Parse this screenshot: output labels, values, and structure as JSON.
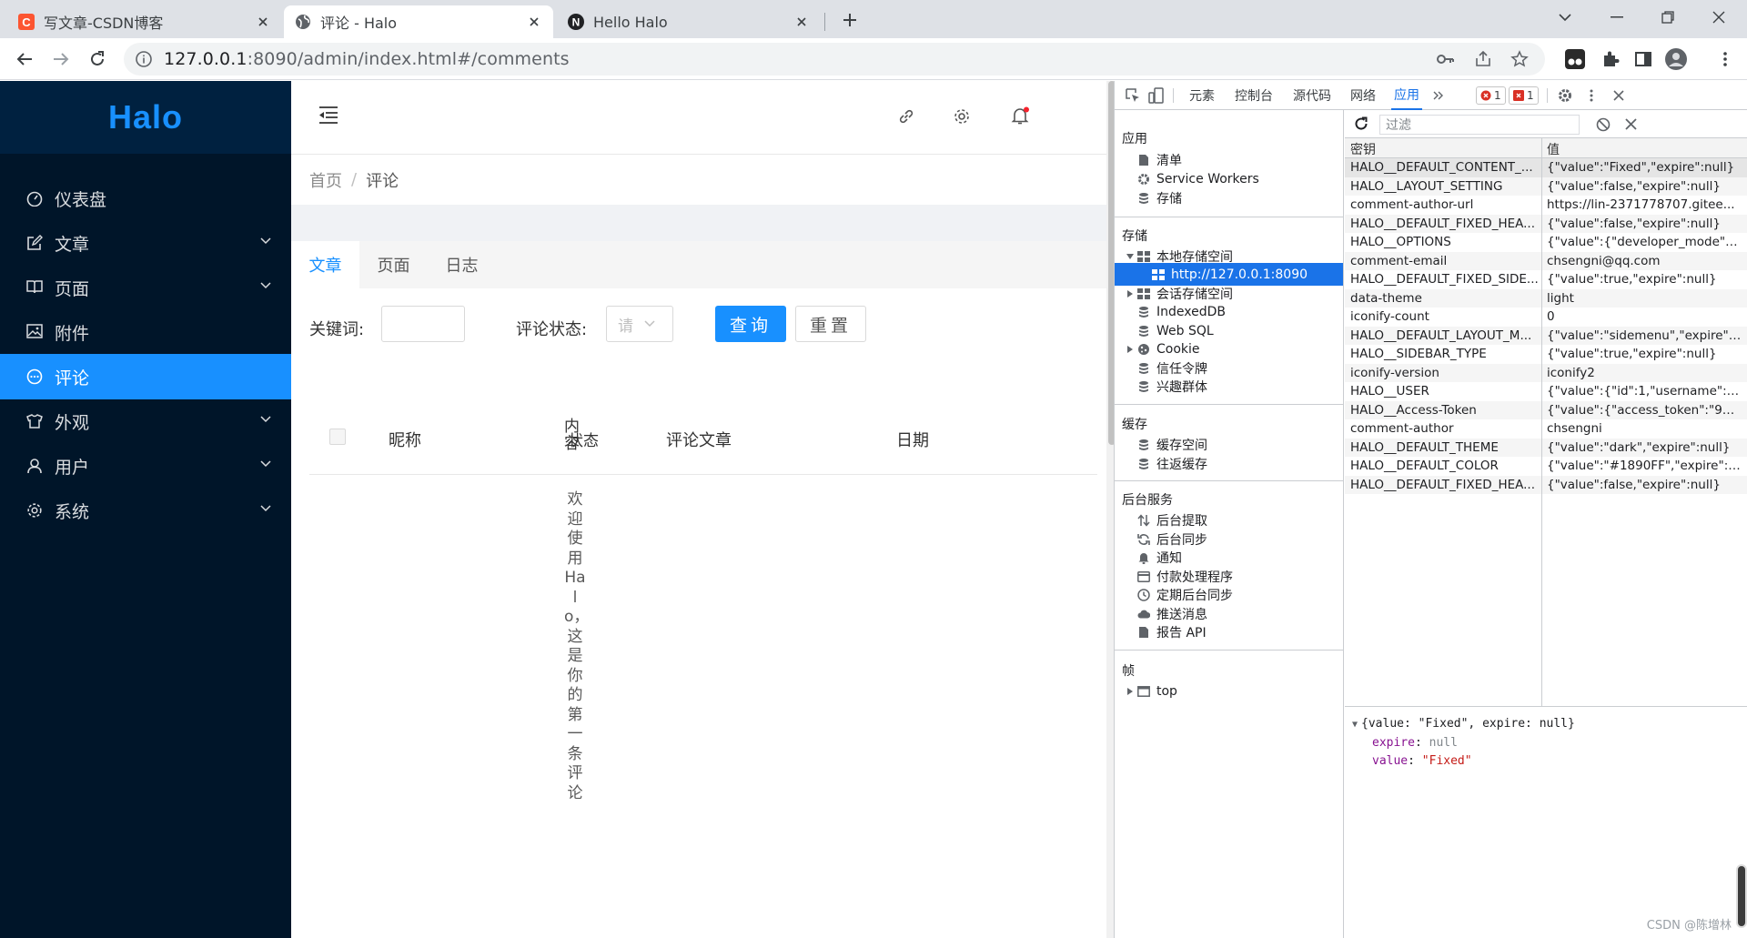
{
  "browser": {
    "tabs": [
      {
        "title": "写文章-CSDN博客",
        "favicon": "csdn-c-icon",
        "active": false
      },
      {
        "title": "评论 - Halo",
        "favicon": "globe-icon",
        "active": true
      },
      {
        "title": "Hello Halo",
        "favicon": "halo-n-icon",
        "active": false
      }
    ],
    "url_host": "127.0.0.1",
    "url_rest": ":8090/admin/index.html#/comments"
  },
  "halo": {
    "logo": "Halo",
    "menu": [
      {
        "label": "仪表盘",
        "icon": "dashboard-icon",
        "arrow": false,
        "active": false
      },
      {
        "label": "文章",
        "icon": "form-icon",
        "arrow": true,
        "active": false
      },
      {
        "label": "页面",
        "icon": "read-icon",
        "arrow": true,
        "active": false
      },
      {
        "label": "附件",
        "icon": "picture-icon",
        "arrow": false,
        "active": false
      },
      {
        "label": "评论",
        "icon": "message-icon",
        "arrow": false,
        "active": true
      },
      {
        "label": "外观",
        "icon": "skin-icon",
        "arrow": true,
        "active": false
      },
      {
        "label": "用户",
        "icon": "user-icon",
        "arrow": true,
        "active": false
      },
      {
        "label": "系统",
        "icon": "setting-icon",
        "arrow": true,
        "active": false
      }
    ],
    "breadcrumb": {
      "home": "首页",
      "sep": "/",
      "current": "评论"
    },
    "content_tabs": [
      "文章",
      "页面",
      "日志"
    ],
    "filter": {
      "keyword_label": "关键词:",
      "status_label": "评论状态:",
      "status_placeholder": "请",
      "query_button": "查询",
      "reset_button": "重置"
    },
    "table": {
      "headers": {
        "nickname": "昵称",
        "content": "内容",
        "status": "状态",
        "post": "评论文章",
        "date": "日期"
      },
      "comment": "欢迎使用Halo，这是你的第一条评论"
    }
  },
  "devtools": {
    "tabs": [
      "元素",
      "控制台",
      "源代码",
      "网络",
      "应用"
    ],
    "active_tab": "应用",
    "errors": "1",
    "warnings": "1",
    "sidebar": {
      "app_title": "应用",
      "app_items": [
        "清单",
        "Service Workers",
        "存储"
      ],
      "storage_title": "存储",
      "local_storage": "本地存储空间",
      "local_origin": "http://127.0.0.1:8090",
      "session_storage": "会话存储空间",
      "storage_items": [
        "IndexedDB",
        "Web SQL",
        "Cookie",
        "信任令牌",
        "兴趣群体"
      ],
      "cache_title": "缓存",
      "cache_items": [
        "缓存空间",
        "往返缓存"
      ],
      "bg_title": "后台服务",
      "bg_items": [
        "后台提取",
        "后台同步",
        "通知",
        "付款处理程序",
        "定期后台同步",
        "推送消息",
        "报告 API"
      ],
      "frames_title": "帧",
      "frames_top": "top"
    },
    "filter_placeholder": "过滤",
    "col_key": "密钥",
    "col_value": "值",
    "rows": [
      {
        "k": "HALO__DEFAULT_CONTENT_...",
        "v": "{\"value\":\"Fixed\",\"expire\":null}"
      },
      {
        "k": "HALO__LAYOUT_SETTING",
        "v": "{\"value\":false,\"expire\":null}"
      },
      {
        "k": "comment-author-url",
        "v": "https://lin-2371778707.gitee..."
      },
      {
        "k": "HALO__DEFAULT_FIXED_HEA...",
        "v": "{\"value\":false,\"expire\":null}"
      },
      {
        "k": "HALO__OPTIONS",
        "v": "{\"value\":{\"developer_mode\":f..."
      },
      {
        "k": "comment-email",
        "v": "chsengni@qq.com"
      },
      {
        "k": "HALO__DEFAULT_FIXED_SIDE...",
        "v": "{\"value\":true,\"expire\":null}"
      },
      {
        "k": "data-theme",
        "v": "light"
      },
      {
        "k": "iconify-count",
        "v": "0"
      },
      {
        "k": "HALO__DEFAULT_LAYOUT_M...",
        "v": "{\"value\":\"sidemenu\",\"expire\":..."
      },
      {
        "k": "HALO__SIDEBAR_TYPE",
        "v": "{\"value\":true,\"expire\":null}"
      },
      {
        "k": "iconify-version",
        "v": "iconify2"
      },
      {
        "k": "HALO__USER",
        "v": "{\"value\":{\"id\":1,\"username\":\"..."
      },
      {
        "k": "HALO__Access-Token",
        "v": "{\"value\":{\"access_token\":\"91f..."
      },
      {
        "k": "comment-author",
        "v": "chsengni"
      },
      {
        "k": "HALO__DEFAULT_THEME",
        "v": "{\"value\":\"dark\",\"expire\":null}"
      },
      {
        "k": "HALO__DEFAULT_COLOR",
        "v": "{\"value\":\"#1890FF\",\"expire\":n..."
      },
      {
        "k": "HALO__DEFAULT_FIXED_HEA...",
        "v": "{\"value\":false,\"expire\":null}"
      }
    ],
    "preview": {
      "summary": "{value: \"Fixed\", expire: null}",
      "expire_key": "expire",
      "expire_val": "null",
      "value_key": "value",
      "value_val": "\"Fixed\""
    },
    "watermark": "CSDN @陈增林"
  },
  "colors": {
    "accent": "#1890ff",
    "sidebar": "#001529",
    "devtools_select": "#1a73e8"
  }
}
